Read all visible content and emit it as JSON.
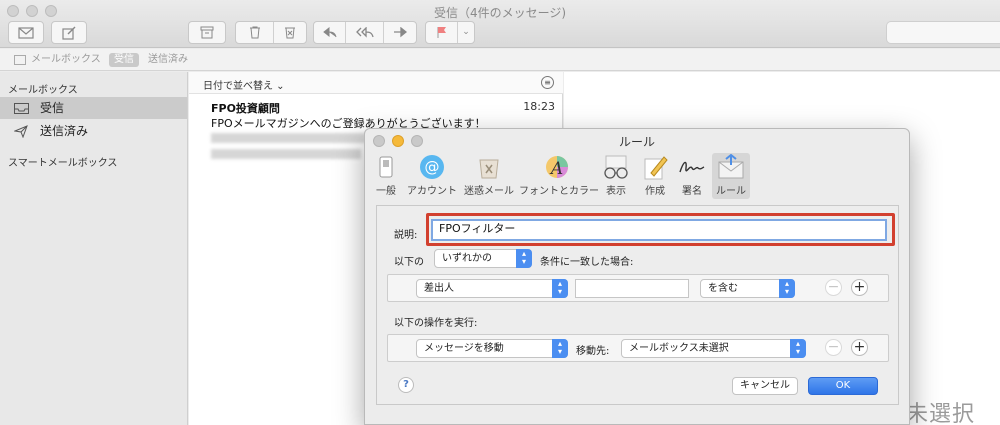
{
  "window": {
    "title": "受信（4件のメッセージ)"
  },
  "toolbar": {
    "icons": [
      "envelope-icon",
      "compose-icon",
      "archive-icon",
      "trash-icon",
      "junk-icon",
      "reply-icon",
      "reply-all-icon",
      "forward-icon",
      "flag-icon"
    ]
  },
  "favorites": {
    "mailboxes": "メールボックス",
    "inbox": "受信",
    "sent": "送信済み"
  },
  "sidebar": {
    "heading": "メールボックス",
    "items": [
      {
        "label": "受信",
        "icon": "inbox-icon",
        "selected": true
      },
      {
        "label": "送信済み",
        "icon": "paper-plane-icon",
        "selected": false
      }
    ],
    "smart_heading": "スマートメールボックス"
  },
  "message_list": {
    "sort_label": "日付で並べ替え ⌄",
    "messages": [
      {
        "from": "FPO投資顧問",
        "time": "18:23",
        "subject": "FPOメールマガジンへのご登録ありがとうございます！"
      }
    ]
  },
  "viewer": {
    "note": "未選択"
  },
  "dialog": {
    "title": "ルール",
    "tabs": [
      {
        "label": "一般",
        "icon": "switch-icon"
      },
      {
        "label": "アカウント",
        "icon": "at-sign-icon"
      },
      {
        "label": "迷惑メール",
        "icon": "junk-bin-icon"
      },
      {
        "label": "フォントとカラー",
        "icon": "font-color-icon"
      },
      {
        "label": "表示",
        "icon": "glasses-icon"
      },
      {
        "label": "作成",
        "icon": "pencil-paper-icon"
      },
      {
        "label": "署名",
        "icon": "signature-icon"
      },
      {
        "label": "ルール",
        "icon": "rules-envelope-icon",
        "selected": true
      }
    ],
    "description_label": "説明:",
    "description_value": "FPOフィルター",
    "if_prefix": "以下の",
    "match_popup": "いずれかの",
    "if_suffix": "条件に一致した場合:",
    "condition": {
      "field": "差出人",
      "value": "",
      "operator": "を含む"
    },
    "action_heading": "以下の操作を実行:",
    "action": {
      "type": "メッセージを移動",
      "target_label": "移動先:",
      "target": "メールボックス未選択"
    },
    "remove_symbol": "−",
    "add_symbol": "+",
    "help_symbol": "?",
    "cancel": "キャンセル",
    "ok": "OK",
    "highlight_color": "#d2402f",
    "accent_color": "#3478f6"
  }
}
